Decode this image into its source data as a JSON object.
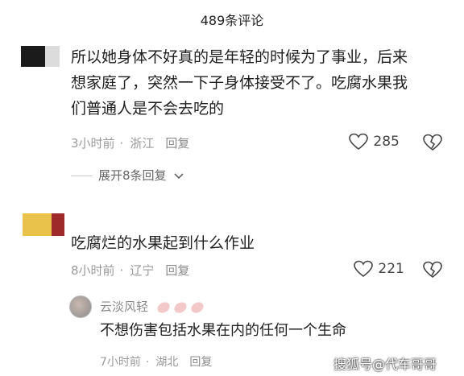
{
  "header": {
    "title": "489条评论"
  },
  "comments": [
    {
      "avatar_colors": [
        "#1b1b1b",
        "#d6d6d6"
      ],
      "text_lines": [
        "所以她身体不好真的是年轻的时候为了事业，后来",
        "想家庭了，突然一下子身体接受不了。吃腐水果我",
        "们普通人是不会去吃的"
      ],
      "time": "3小时前",
      "location": "浙江",
      "reply_label": "回复",
      "likes": "285",
      "expand_label": "展开8条回复"
    },
    {
      "avatar_colors": [
        "#e8c24a",
        "#9e2a2a"
      ],
      "text_lines": [
        "吃腐烂的水果起到什么作业"
      ],
      "time": "8小时前",
      "location": "辽宁",
      "reply_label": "回复",
      "likes": "221"
    }
  ],
  "reply": {
    "username": "云淡风轻",
    "text": "不想伤害包括水果在内的任何一个生命",
    "time": "7小时前",
    "location": "湖北",
    "reply_label": "回复"
  },
  "watermark": "搜狐号@代车哥哥",
  "colors": {
    "heart_stroke": "#444444",
    "badge": "#e9a3a3"
  }
}
